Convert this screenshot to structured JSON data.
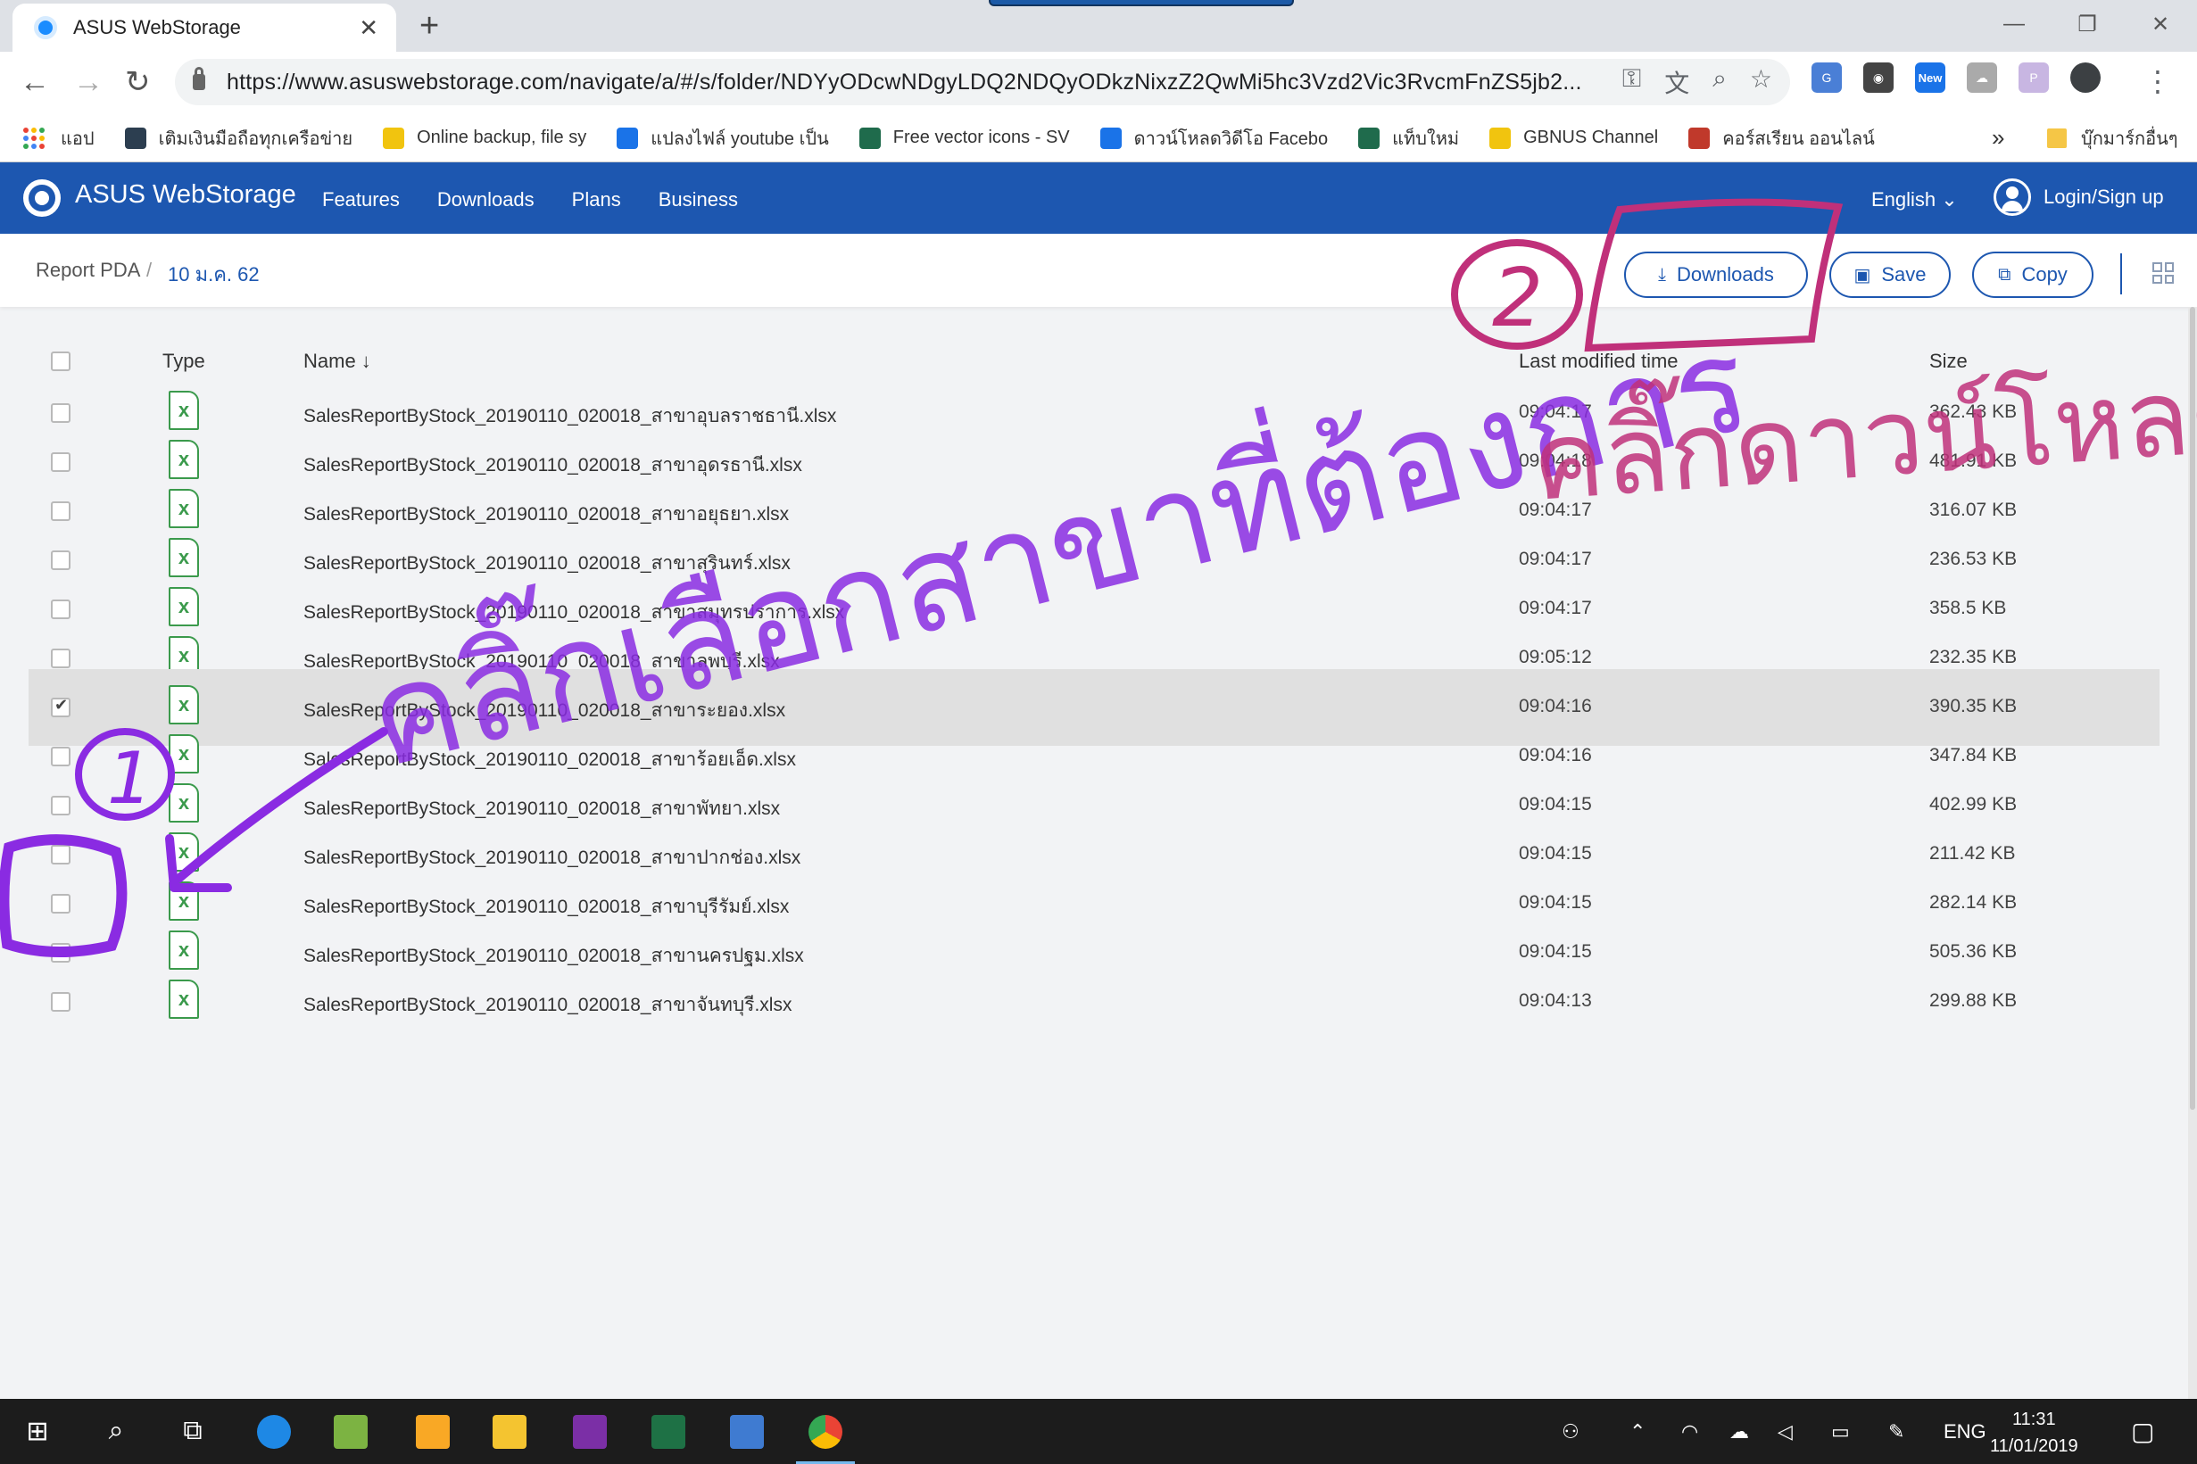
{
  "browser": {
    "tab_title": "ASUS WebStorage",
    "tab_close": "✕",
    "new_tab": "+",
    "url": "https://www.asuswebstorage.com/navigate/a/#/s/folder/NDYyODcwNDgyLDQ2NDQyODkzNixzZ2QwMi5hc3Vzd2Vic3RvcmFnZS5jb2...",
    "new_badge": "New",
    "bookmarks": [
      {
        "label": "แอป",
        "color": "#e74c3c"
      },
      {
        "label": "เติมเงินมือถือทุกเครือข่าย",
        "color": "#2c3e50"
      },
      {
        "label": "Online backup, file sy",
        "color": "#f1c40f"
      },
      {
        "label": "แปลงไฟล์ youtube เป็น",
        "color": "#1a73e8"
      },
      {
        "label": "Free vector icons - SV",
        "color": "#1f6b4c"
      },
      {
        "label": "ดาวน์โหลดวิดีโอ Facebo",
        "color": "#1a73e8"
      },
      {
        "label": "แท็บใหม่",
        "color": "#1f6b4c"
      },
      {
        "label": "GBNUS Channel",
        "color": "#f1c40f"
      },
      {
        "label": "คอร์สเรียน ออนไลน์",
        "color": "#c0392b"
      }
    ],
    "bookmarks_more": "»",
    "other_bookmarks": "บุ๊กมาร์กอื่นๆ"
  },
  "app": {
    "brand": "ASUS WebStorage",
    "nav": [
      "Features",
      "Downloads",
      "Plans",
      "Business"
    ],
    "language": "English ⌄",
    "login": "Login/Sign up",
    "accent": "#1d57b0"
  },
  "breadcrumb": {
    "root": "Report PDA",
    "sep": "/",
    "current": "10 ม.ค. 62"
  },
  "actions": {
    "downloads": "Downloads",
    "save": "Save",
    "copy": "Copy"
  },
  "table": {
    "headers": {
      "type": "Type",
      "name": "Name ↓",
      "modified": "Last modified time",
      "size": "Size"
    },
    "rows": [
      {
        "name": "SalesReportByStock_20190110_020018_สาขาอุบลราชธานี.xlsx",
        "time": "09:04:17",
        "size": "362.43 KB",
        "checked": false
      },
      {
        "name": "SalesReportByStock_20190110_020018_สาขาอุดรธานี.xlsx",
        "time": "09:04:18",
        "size": "481.91 KB",
        "checked": false
      },
      {
        "name": "SalesReportByStock_20190110_020018_สาขาอยุธยา.xlsx",
        "time": "09:04:17",
        "size": "316.07 KB",
        "checked": false
      },
      {
        "name": "SalesReportByStock_20190110_020018_สาขาสุรินทร์.xlsx",
        "time": "09:04:17",
        "size": "236.53 KB",
        "checked": false
      },
      {
        "name": "SalesReportByStock_20190110_020018_สาขาสมุทรปราการ.xlsx",
        "time": "09:04:17",
        "size": "358.5 KB",
        "checked": false
      },
      {
        "name": "SalesReportByStock_20190110_020018_สาขาลพบุรี.xlsx",
        "time": "09:05:12",
        "size": "232.35 KB",
        "checked": false
      },
      {
        "name": "SalesReportByStock_20190110_020018_สาขาระยอง.xlsx",
        "time": "09:04:16",
        "size": "390.35 KB",
        "checked": true
      },
      {
        "name": "SalesReportByStock_20190110_020018_สาขาร้อยเอ็ด.xlsx",
        "time": "09:04:16",
        "size": "347.84 KB",
        "checked": false
      },
      {
        "name": "SalesReportByStock_20190110_020018_สาขาพัทยา.xlsx",
        "time": "09:04:15",
        "size": "402.99 KB",
        "checked": false
      },
      {
        "name": "SalesReportByStock_20190110_020018_สาขาปากช่อง.xlsx",
        "time": "09:04:15",
        "size": "211.42 KB",
        "checked": false
      },
      {
        "name": "SalesReportByStock_20190110_020018_สาขาบุรีรัมย์.xlsx",
        "time": "09:04:15",
        "size": "282.14 KB",
        "checked": false
      },
      {
        "name": "SalesReportByStock_20190110_020018_สาขานครปฐม.xlsx",
        "time": "09:04:15",
        "size": "505.36 KB",
        "checked": false
      },
      {
        "name": "SalesReportByStock_20190110_020018_สาขาจันทบุรี.xlsx",
        "time": "09:04:13",
        "size": "299.88 KB",
        "checked": false
      }
    ]
  },
  "annotations": {
    "step1_number": "1",
    "step1_text": "คลิ๊กเลือกสาขาที่ต้องการ",
    "step2_number": "2",
    "step2_text": "คลิ๊กดาวน์โหลด",
    "ink_purple": "#8a2be2",
    "ink_pink": "#c0307a"
  },
  "taskbar": {
    "language": "ENG",
    "time": "11:31",
    "date": "11/01/2019"
  }
}
